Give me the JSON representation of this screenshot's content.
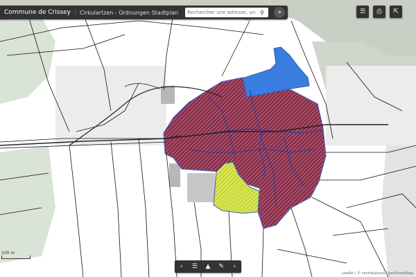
{
  "header": {
    "title": "Commune de Crissey",
    "subtitle": "Cirkulartzen - Ordnungen Stadtplan",
    "search_placeholder": "Rechercher une adresse, un lieu",
    "search_icon": "search-icon",
    "expand_icon": "chevrons-icon"
  },
  "toolbar_right": {
    "buttons": [
      "list-icon",
      "print-icon",
      "share-icon"
    ]
  },
  "bottom_toolbar": {
    "buttons": [
      "chevron-left-icon",
      "list-icon",
      "pin-icon",
      "pencil-icon",
      "chevron-right-icon"
    ]
  },
  "scale": {
    "label": "100 m"
  },
  "attribution": "Leaflet | © contributeurs OpenStreetMap",
  "colors": {
    "land": "#ffffff",
    "forest": "#d9e3d6",
    "built": "#b7b7b7",
    "zone_residential": "#8a2f4a",
    "zone_water": "#3a7de0",
    "zone_green": "#d7e64f",
    "parcel_line": "#111111"
  },
  "legend": {
    "zones": [
      "residential-zone",
      "blue-zone",
      "green-zone"
    ]
  }
}
